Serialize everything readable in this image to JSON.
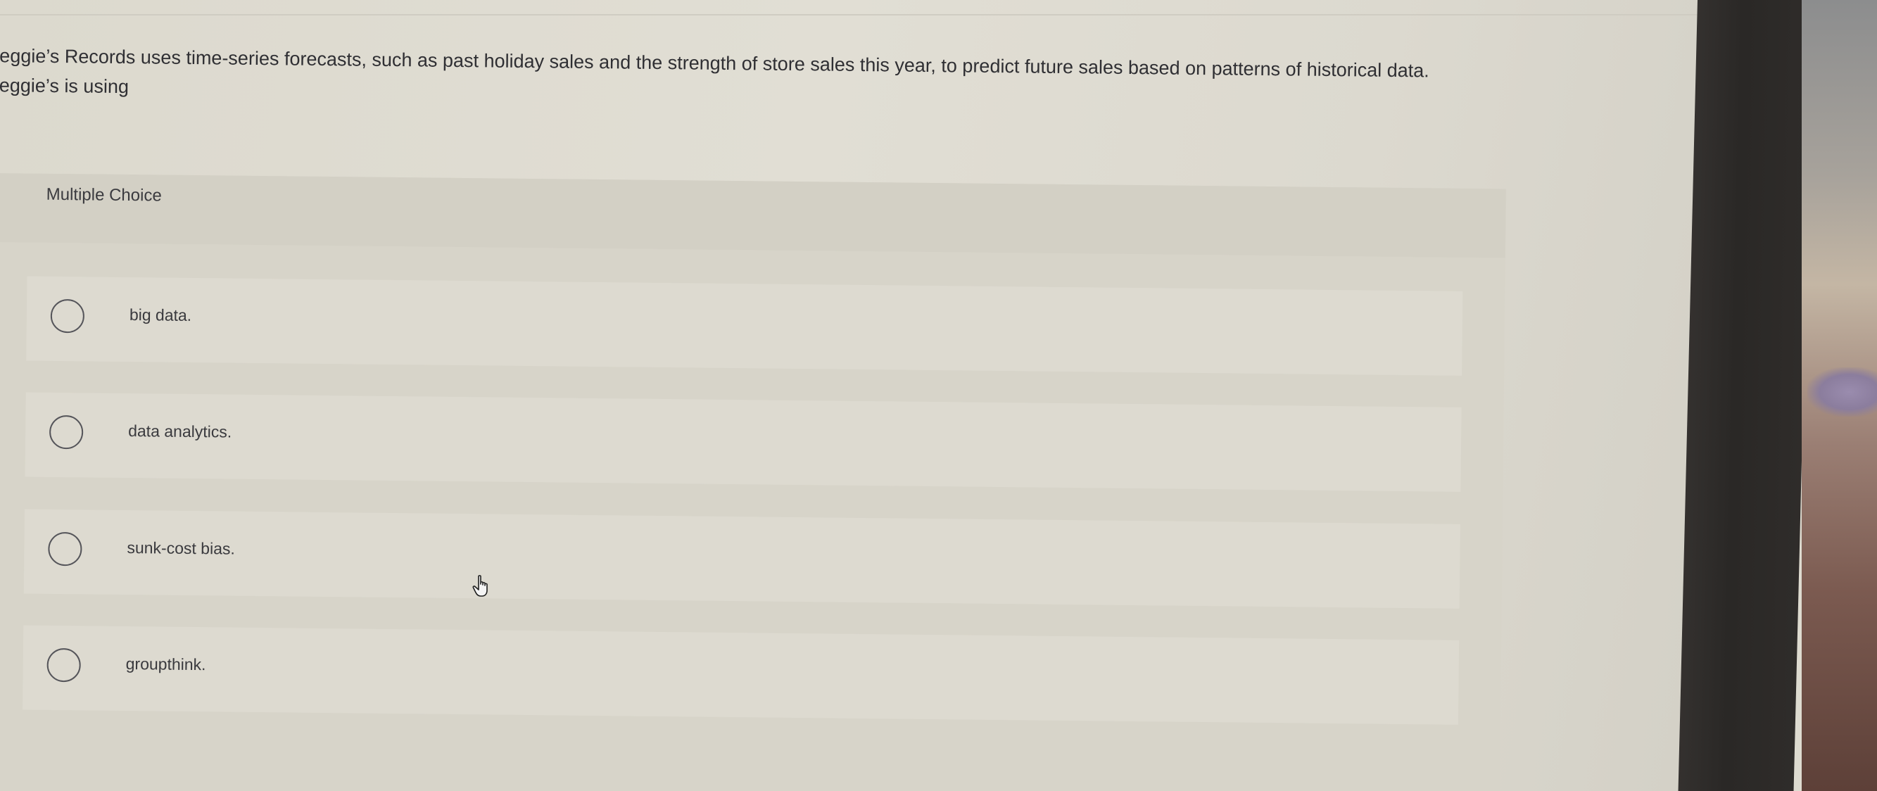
{
  "question": {
    "text": "Reggie’s Records uses time-series forecasts, such as past holiday sales and the strength of store sales this year, to predict future sales based on patterns of historical data. Reggie’s is using"
  },
  "multiple_choice": {
    "header_label": "Multiple Choice",
    "options": [
      {
        "label": "big data."
      },
      {
        "label": "data analytics."
      },
      {
        "label": "sunk-cost bias."
      },
      {
        "label": "groupthink."
      }
    ]
  },
  "icons": {
    "radio": "radio-circle-icon",
    "cursor": "hand-pointer-icon"
  },
  "colors": {
    "page_background": "#e0ddd3",
    "panel_background": "#d7d4c9",
    "option_background": "#dddad0",
    "text": "#2f2f33"
  }
}
